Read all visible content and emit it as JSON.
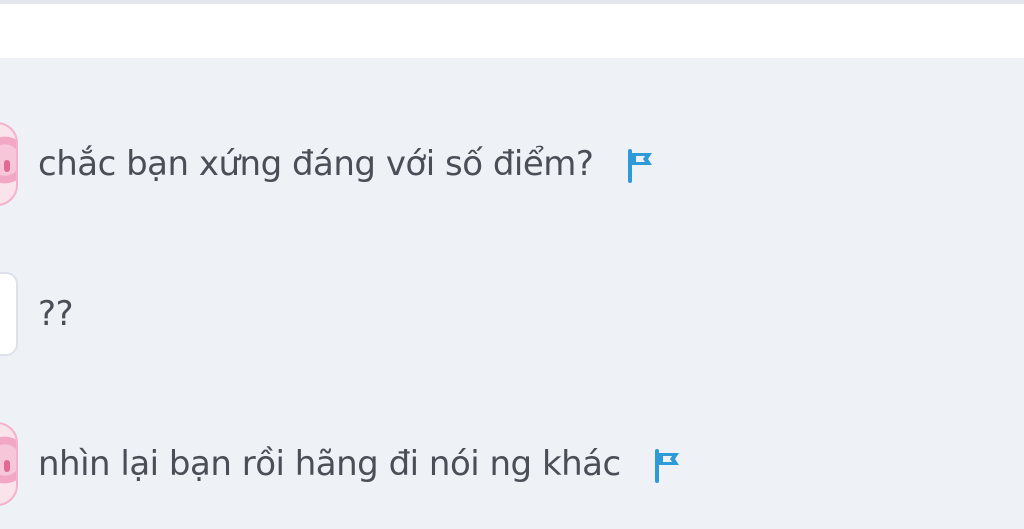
{
  "comments": [
    {
      "text": "chắc bạn xứng đáng với số điểm?",
      "avatar": "pink-avatar",
      "has_flag": true
    },
    {
      "text": "??",
      "avatar": "plain-avatar",
      "has_flag": false
    },
    {
      "text": "nhìn lại bạn rồi hãng đi nói ng khác",
      "avatar": "pink-avatar",
      "has_flag": true
    }
  ],
  "icons": {
    "flag": "flag-icon",
    "flag_color": "#2f9ad8"
  },
  "colors": {
    "background": "#eef1f6",
    "text": "#4a4f57"
  }
}
